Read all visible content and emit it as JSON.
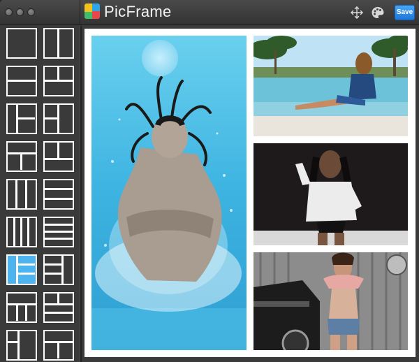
{
  "window": {
    "title": "PicFrame",
    "save_label": "Save",
    "toolbar_icons": [
      "move-arrows-icon",
      "palette-icon"
    ]
  },
  "colors": {
    "accent": "#4db4f0",
    "save_button": "#2a8ae6",
    "sidebar_bg": "#3a3a3a",
    "frame_bg": "#ffffff"
  },
  "sidebar": {
    "templates": [
      {
        "id": "single"
      },
      {
        "id": "two-columns"
      },
      {
        "id": "two-rows"
      },
      {
        "id": "three-top-split"
      },
      {
        "id": "left-column-two-right"
      },
      {
        "id": "big-top-two-bottom"
      },
      {
        "id": "top-two-bottom-one"
      },
      {
        "id": "two-top-one-bottom"
      },
      {
        "id": "three-columns"
      },
      {
        "id": "three-rows"
      },
      {
        "id": "four-columns"
      },
      {
        "id": "four-rows"
      },
      {
        "id": "left-tall-three-right",
        "selected": true
      },
      {
        "id": "right-tall-three-left"
      },
      {
        "id": "top-wide-three-bottom"
      },
      {
        "id": "two-top-three-bottom"
      },
      {
        "id": "mixed-a"
      },
      {
        "id": "mixed-b"
      }
    ]
  },
  "canvas": {
    "photos": [
      {
        "id": "underwater-splash"
      },
      {
        "id": "pool-beach"
      },
      {
        "id": "studio-shirt"
      },
      {
        "id": "vintage-car"
      }
    ]
  }
}
